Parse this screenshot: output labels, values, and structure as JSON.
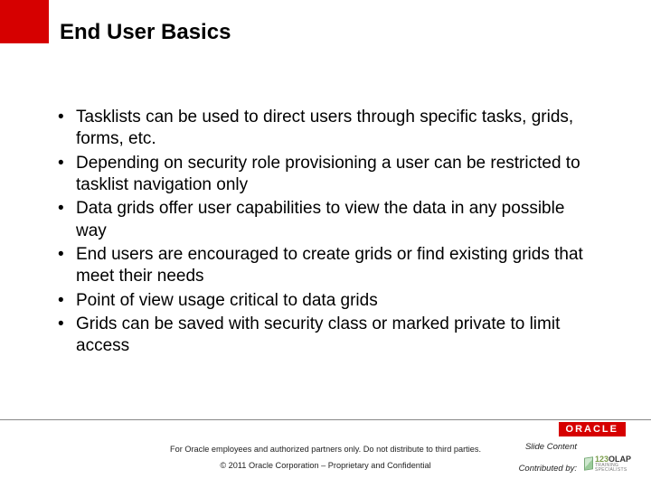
{
  "title": "End User Basics",
  "bullets": [
    "Tasklists can be used to direct users through specific tasks, grids, forms, etc.",
    "Depending on security role provisioning a user can be restricted to tasklist navigation only",
    "Data grids offer user capabilities to view the data in any possible way",
    "End users are encouraged to create grids or find existing grids that meet their needs",
    "Point of view usage critical to data grids",
    "Grids can be saved with security class or marked private to limit access"
  ],
  "footer": {
    "line1": "For Oracle employees and authorized partners only. Do not distribute to third parties.",
    "line2": "© 2011 Oracle Corporation – Proprietary and Confidential"
  },
  "labels": {
    "slide_content": "Slide Content",
    "contributed_by": "Contributed by:"
  },
  "logos": {
    "oracle": "ORACLE",
    "olap_num": "123",
    "olap_word": "OLAP",
    "olap_sub": "TRAINING SPECIALISTS"
  }
}
